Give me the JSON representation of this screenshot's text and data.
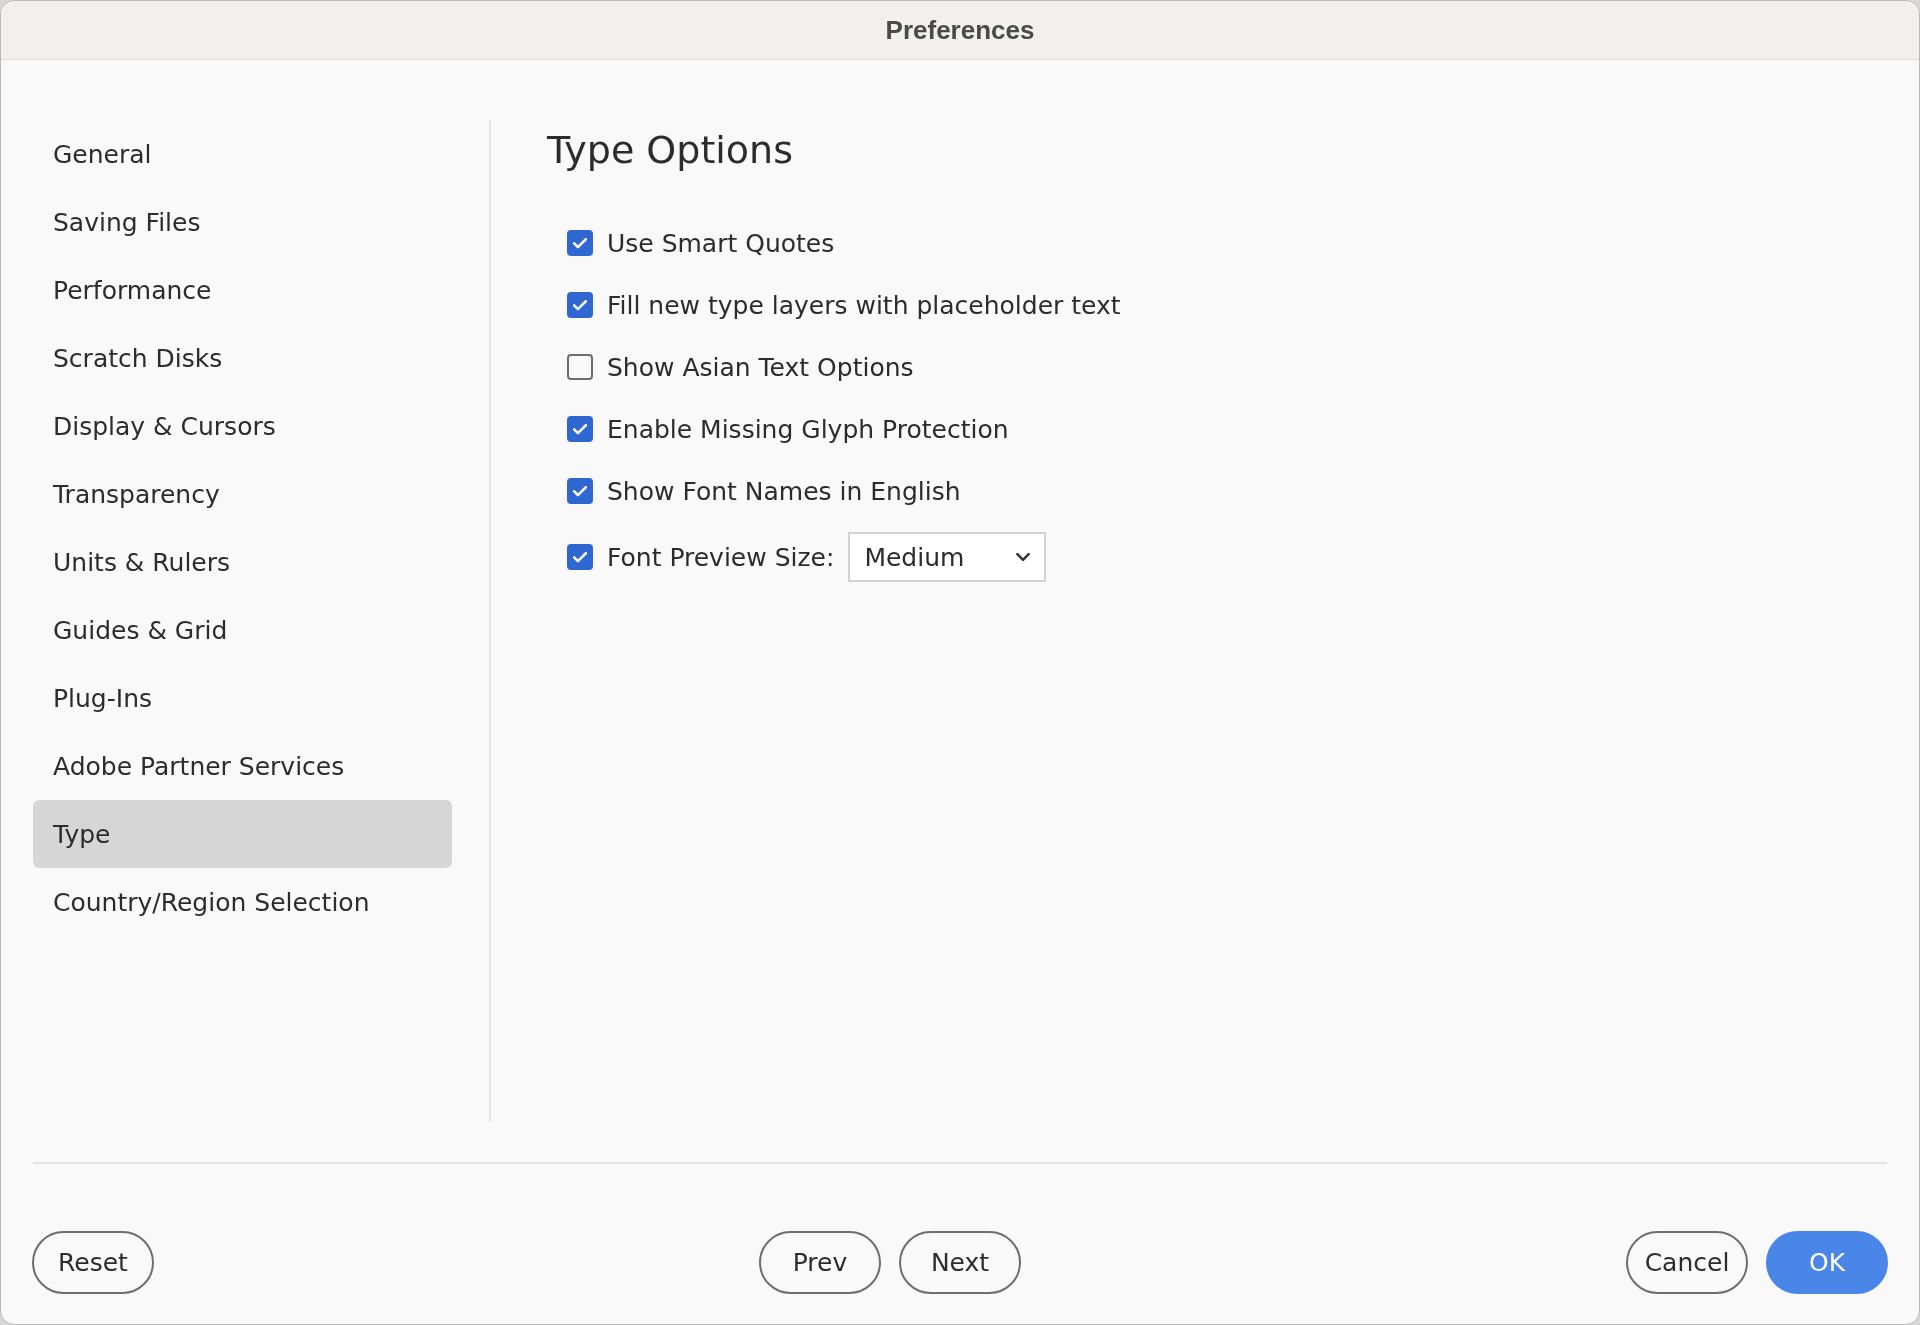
{
  "window": {
    "title": "Preferences"
  },
  "sidebar": {
    "items": [
      {
        "label": "General",
        "selected": false
      },
      {
        "label": "Saving Files",
        "selected": false
      },
      {
        "label": "Performance",
        "selected": false
      },
      {
        "label": "Scratch Disks",
        "selected": false
      },
      {
        "label": "Display & Cursors",
        "selected": false
      },
      {
        "label": "Transparency",
        "selected": false
      },
      {
        "label": "Units & Rulers",
        "selected": false
      },
      {
        "label": "Guides & Grid",
        "selected": false
      },
      {
        "label": "Plug-Ins",
        "selected": false
      },
      {
        "label": "Adobe Partner Services",
        "selected": false
      },
      {
        "label": "Type",
        "selected": true
      },
      {
        "label": "Country/Region Selection",
        "selected": false
      }
    ]
  },
  "content": {
    "heading": "Type Options",
    "options": [
      {
        "kind": "checkbox",
        "label": "Use Smart Quotes",
        "checked": true
      },
      {
        "kind": "checkbox",
        "label": "Fill new type layers with placeholder text",
        "checked": true
      },
      {
        "kind": "checkbox",
        "label": "Show Asian Text Options",
        "checked": false
      },
      {
        "kind": "checkbox",
        "label": "Enable Missing Glyph Protection",
        "checked": true
      },
      {
        "kind": "checkbox",
        "label": "Show Font Names in English",
        "checked": true
      },
      {
        "kind": "select",
        "label": "Font Preview Size:",
        "checked": true,
        "value": "Medium"
      }
    ]
  },
  "footer": {
    "left": [
      {
        "label": "Reset",
        "primary": false
      }
    ],
    "center": [
      {
        "label": "Prev",
        "primary": false
      },
      {
        "label": "Next",
        "primary": false
      }
    ],
    "right": [
      {
        "label": "Cancel",
        "primary": false
      },
      {
        "label": "OK",
        "primary": true
      }
    ]
  }
}
